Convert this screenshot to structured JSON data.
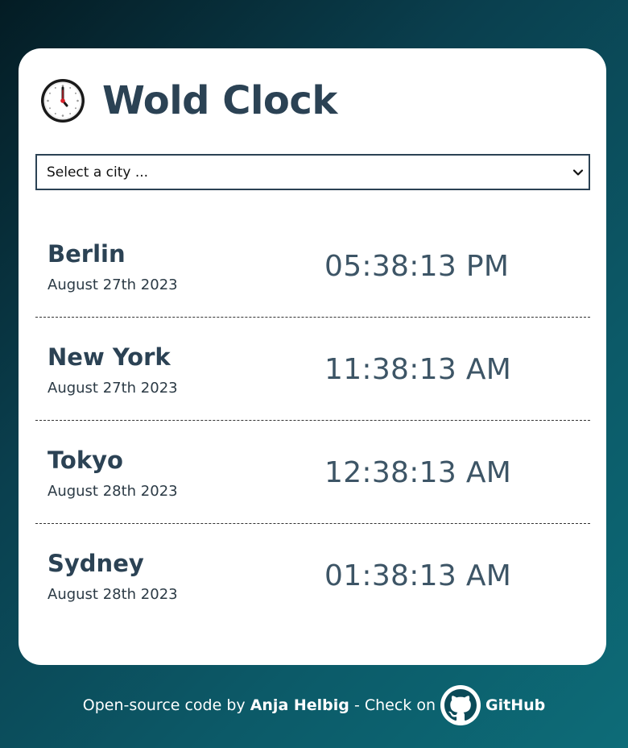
{
  "app": {
    "title": "Wold Clock",
    "icon": "clock-icon"
  },
  "city_select": {
    "selected_label": "Select a city ...",
    "icon": "chevron-down-icon"
  },
  "cities": [
    {
      "name": "Berlin",
      "date": "August 27th 2023",
      "time": "05:38:13 PM"
    },
    {
      "name": "New York",
      "date": "August 27th 2023",
      "time": "11:38:13 AM"
    },
    {
      "name": "Tokyo",
      "date": "August 28th 2023",
      "time": "12:38:13 AM"
    },
    {
      "name": "Sydney",
      "date": "August 28th 2023",
      "time": "01:38:13 AM"
    }
  ],
  "footer": {
    "prefix": "Open-source code by",
    "author": "Anja Helbig",
    "middle": "- Check on",
    "link_label": "GitHub",
    "link_icon": "github-icon"
  },
  "colors": {
    "heading": "#2b4254",
    "time": "#3d5566",
    "background_start": "#041c24",
    "background_end": "#0d6c78"
  }
}
